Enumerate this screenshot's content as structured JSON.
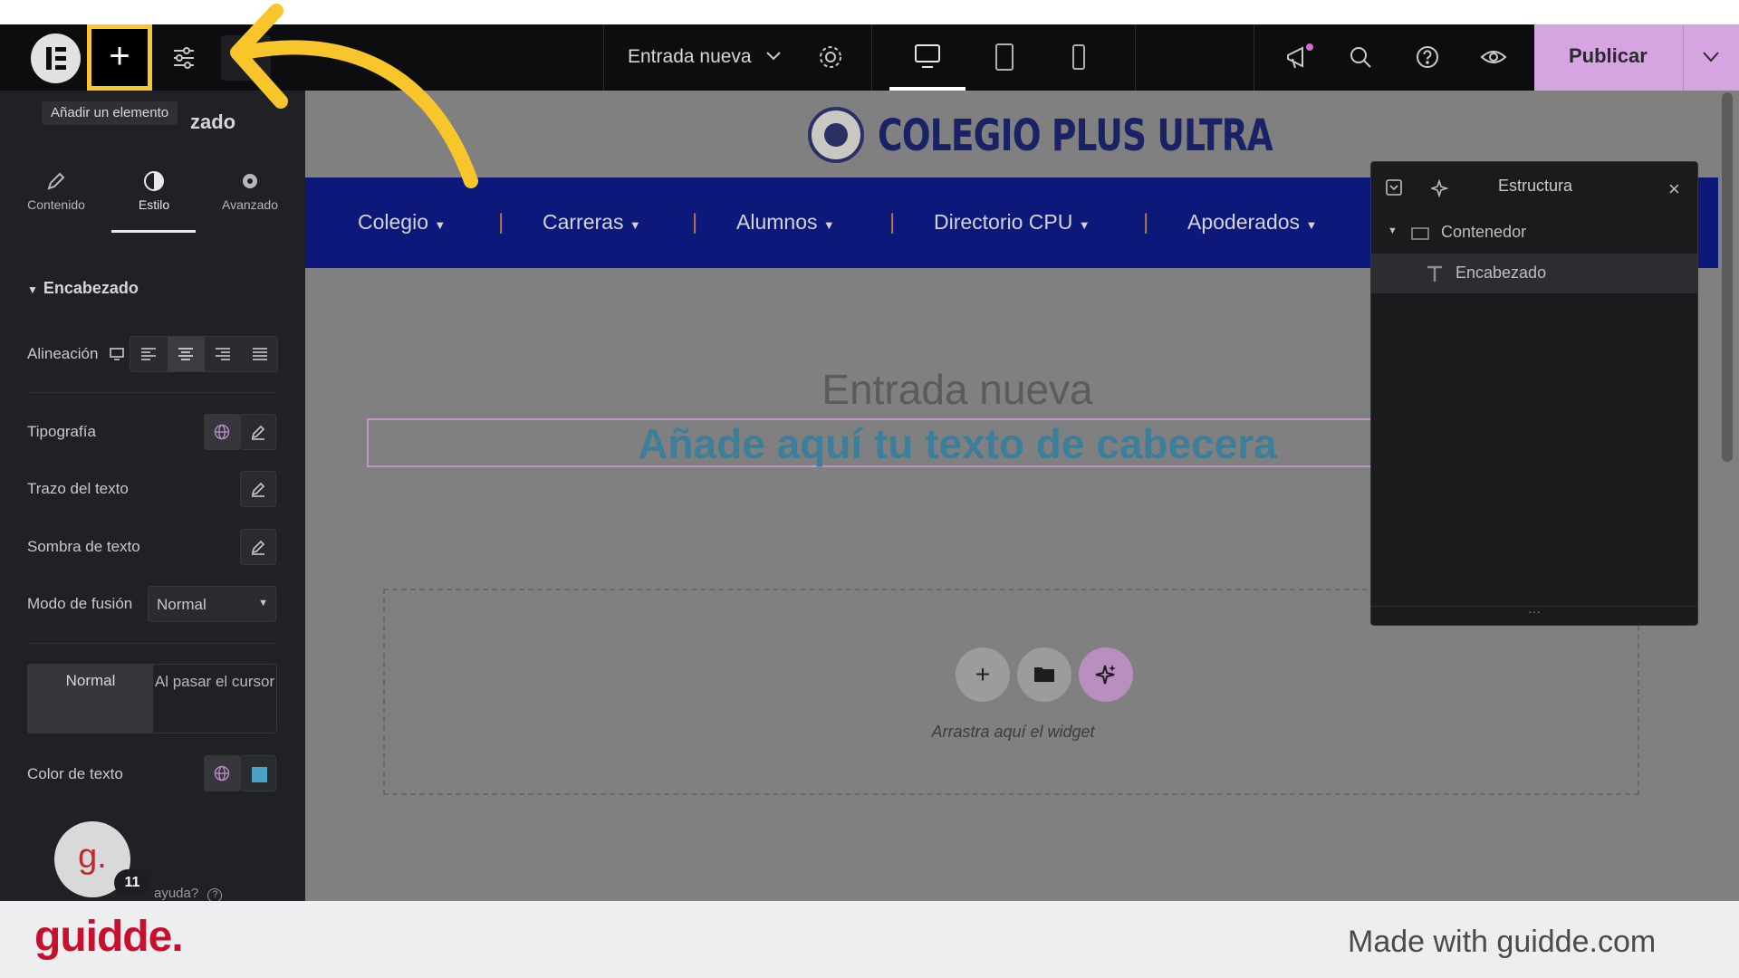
{
  "topbar": {
    "add_tooltip": "Añadir un elemento",
    "document_title": "Entrada nueva",
    "publish_label": "Publicar"
  },
  "left_panel": {
    "obscured_title": "Editar Encabezado",
    "title_visible_part": "zado",
    "tabs": [
      {
        "label": "Contenido",
        "icon": "pencil-icon"
      },
      {
        "label": "Estilo",
        "icon": "half-circle-icon"
      },
      {
        "label": "Avanzado",
        "icon": "gear-icon"
      }
    ],
    "section_title": "Encabezado",
    "alignment_label": "Alineación",
    "typography_label": "Tipografía",
    "stroke_label": "Trazo del texto",
    "shadow_label": "Sombra de texto",
    "blend_label": "Modo de fusión",
    "blend_value": "Normal",
    "state_normal": "Normal",
    "state_hover": "Al pasar el cursor",
    "text_color_label": "Color de texto",
    "help_badge": "11",
    "help_text": "ayuda?"
  },
  "site": {
    "title": "COLEGIO PLUS ULTRA",
    "nav": [
      "Colegio",
      "Carreras",
      "Alumnos",
      "Directorio CPU",
      "Apoderados"
    ],
    "post_title": "Entrada nueva",
    "heading_placeholder": "Añade aquí tu texto de cabecera",
    "drop_zone_text": "Arrastra aquí el widget"
  },
  "structure": {
    "title": "Estructura",
    "items": [
      {
        "label": "Contenedor",
        "icon": "container-icon"
      },
      {
        "label": "Encabezado",
        "icon": "heading-icon"
      }
    ],
    "more": "···"
  },
  "footer": {
    "brand": "guidde.",
    "made_with": "Made with guidde.com"
  },
  "colors": {
    "accent_highlight": "#f8c62a",
    "publish": "#d6a4e0",
    "nav_bar": "#0c197a",
    "brand_red": "#c8102e"
  }
}
